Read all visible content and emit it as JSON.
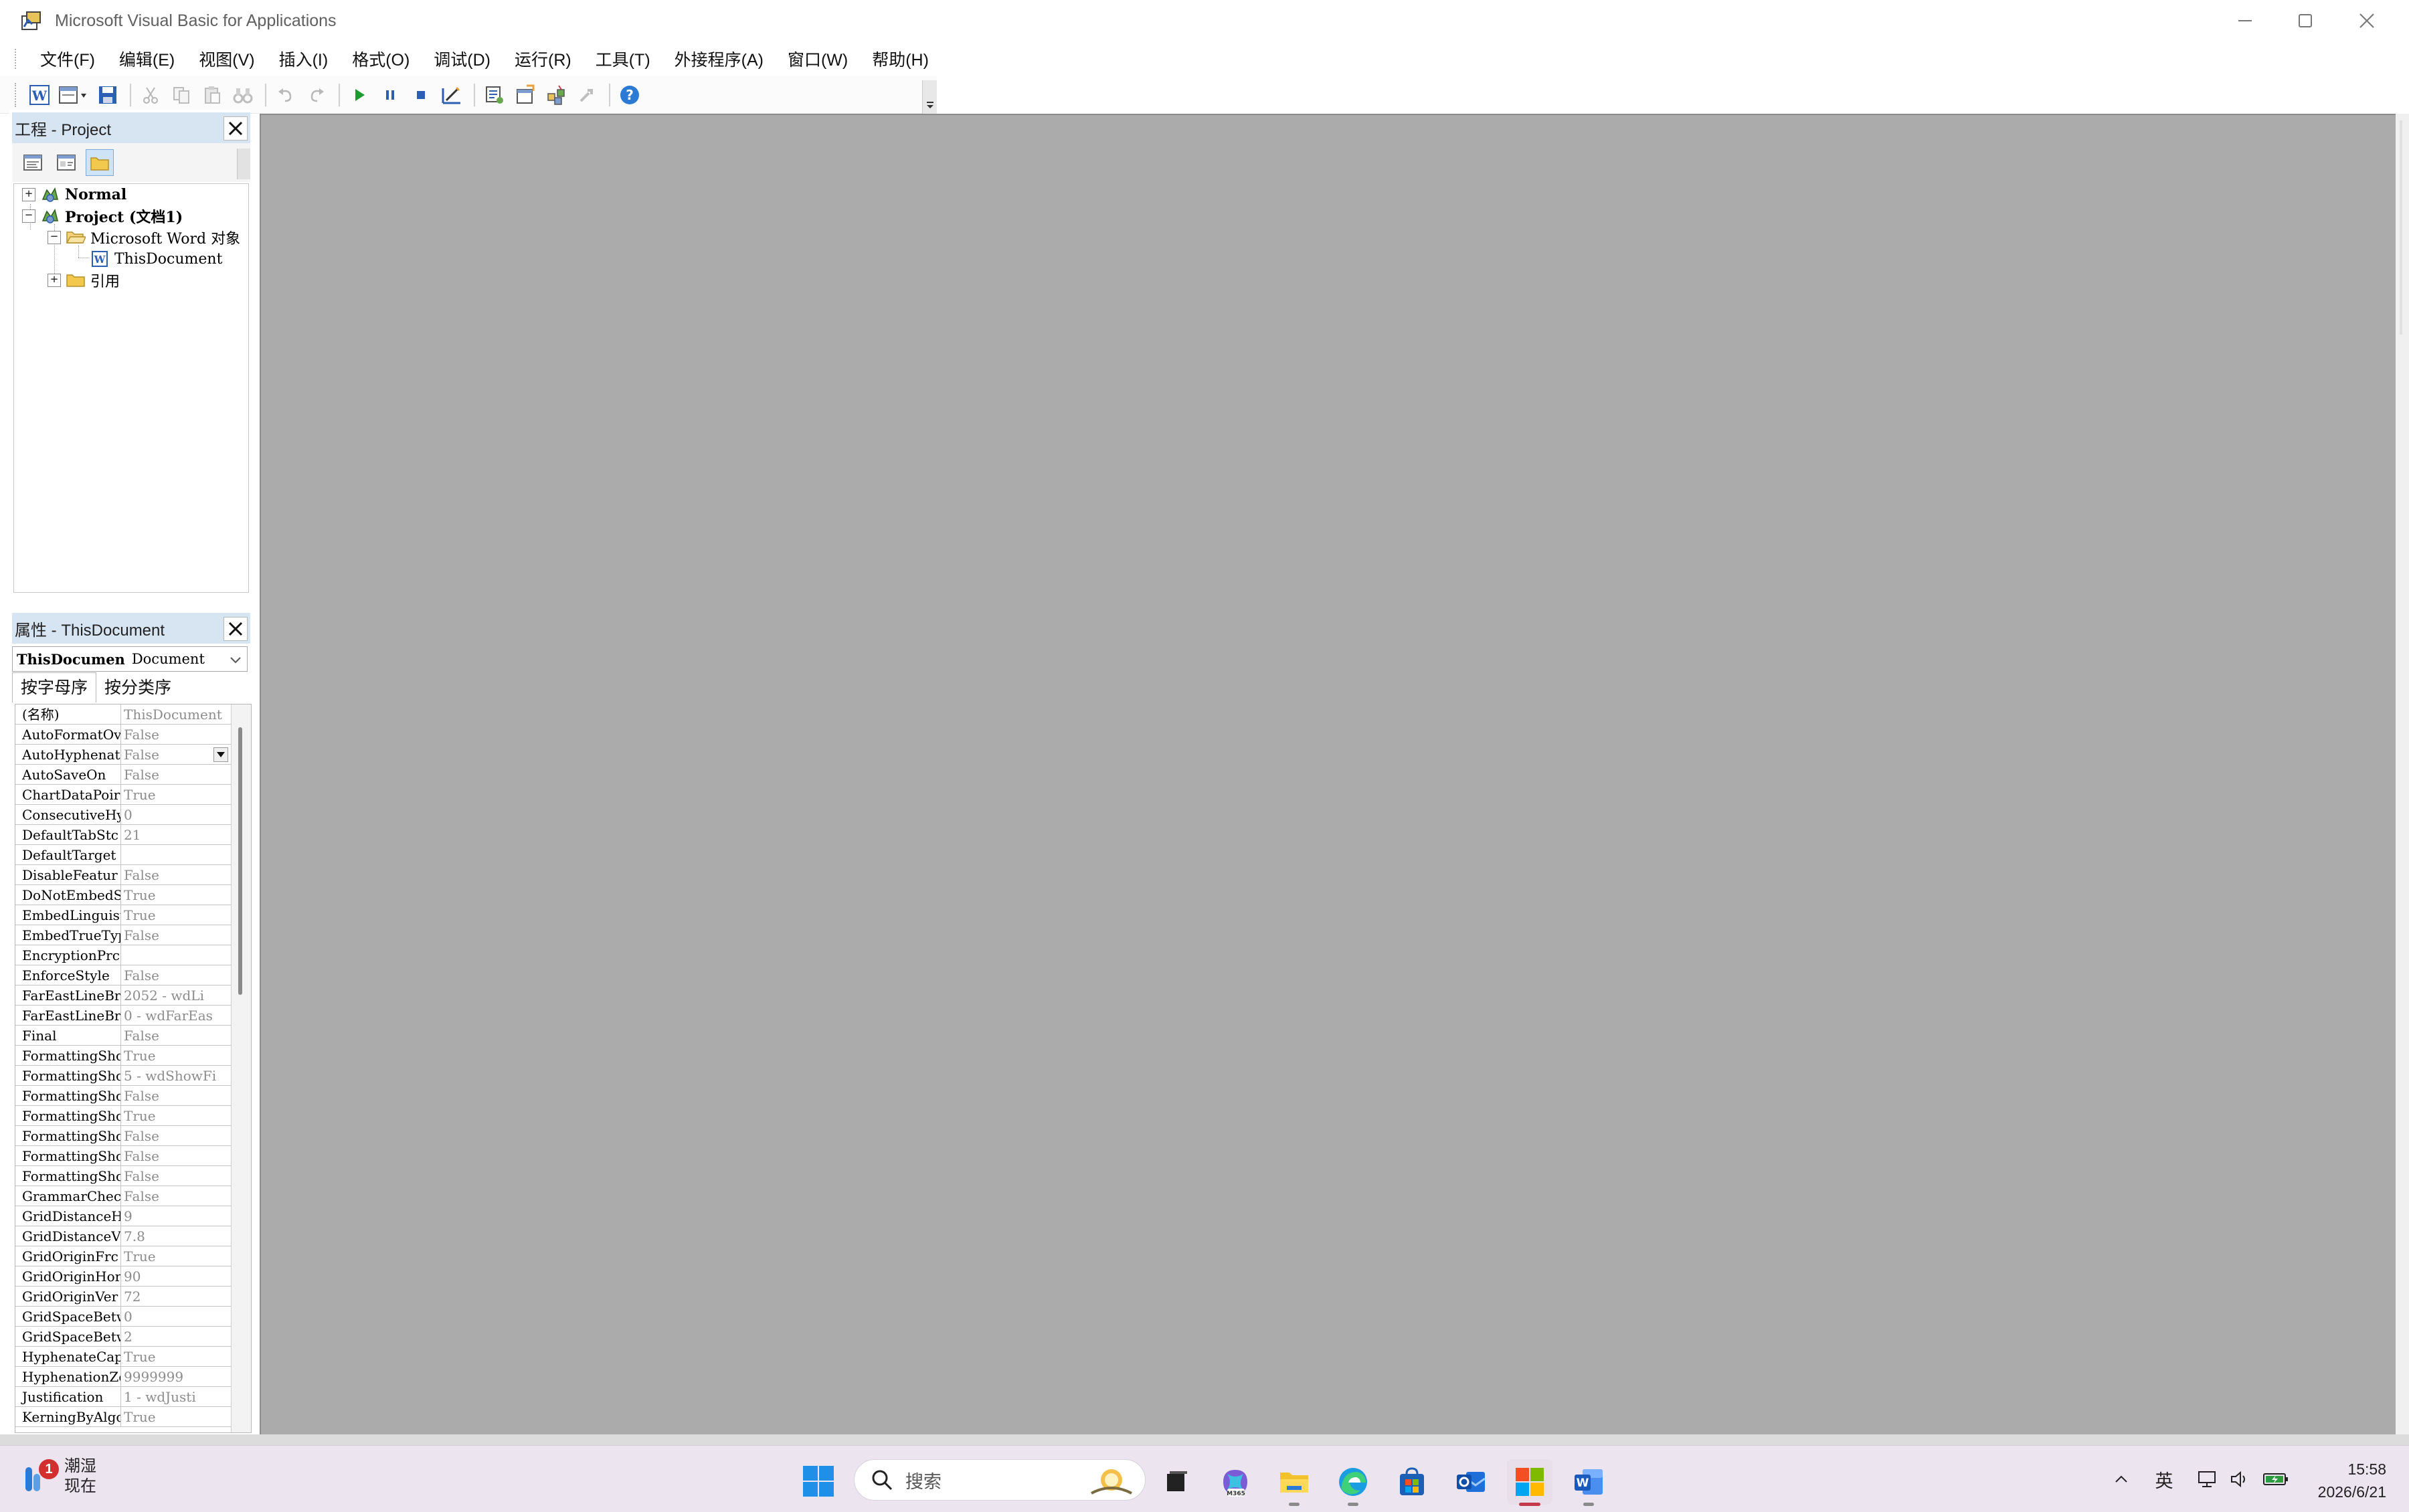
{
  "window": {
    "title": "Microsoft Visual Basic for Applications"
  },
  "menu": [
    "文件(F)",
    "编辑(E)",
    "视图(V)",
    "插入(I)",
    "格式(O)",
    "调试(D)",
    "运行(R)",
    "工具(T)",
    "外接程序(A)",
    "窗口(W)",
    "帮助(H)"
  ],
  "project_pane": {
    "title": "工程 - Project",
    "tree": [
      {
        "label": "Normal",
        "bold": true
      },
      {
        "label": "Project (文档1)",
        "bold": true
      },
      {
        "label": "Microsoft Word 对象",
        "bold": false
      },
      {
        "label": "ThisDocument",
        "bold": false
      },
      {
        "label": "引用",
        "bold": false
      }
    ]
  },
  "properties_pane": {
    "title": "属性 - ThisDocument",
    "object_name": "ThisDocumen",
    "object_class": "Document",
    "tabs": [
      "按字母序",
      "按分类序"
    ],
    "rows": [
      {
        "name": "(名称)",
        "value": "ThisDocument"
      },
      {
        "name": "AutoFormatOve",
        "value": "False"
      },
      {
        "name": "AutoHyphenati",
        "value": "False"
      },
      {
        "name": "AutoSaveOn",
        "value": "False"
      },
      {
        "name": "ChartDataPoir",
        "value": "True"
      },
      {
        "name": "ConsecutiveHy",
        "value": "0"
      },
      {
        "name": "DefaultTabStc",
        "value": "21"
      },
      {
        "name": "DefaultTarget",
        "value": ""
      },
      {
        "name": "DisableFeatur",
        "value": "False"
      },
      {
        "name": "DoNotEmbedSys",
        "value": "True"
      },
      {
        "name": "EmbedLinguist",
        "value": "True"
      },
      {
        "name": "EmbedTrueType",
        "value": "False"
      },
      {
        "name": "EncryptionPrc",
        "value": ""
      },
      {
        "name": "EnforceStyle",
        "value": "False"
      },
      {
        "name": "FarEastLineBr",
        "value": "2052 - wdLi"
      },
      {
        "name": "FarEastLineBr",
        "value": "0 - wdFarEas"
      },
      {
        "name": "Final",
        "value": "False"
      },
      {
        "name": "FormattingShc",
        "value": "True"
      },
      {
        "name": "FormattingShc",
        "value": "5 - wdShowFi"
      },
      {
        "name": "FormattingShc",
        "value": "False"
      },
      {
        "name": "FormattingShc",
        "value": "True"
      },
      {
        "name": "FormattingShc",
        "value": "False"
      },
      {
        "name": "FormattingShc",
        "value": "False"
      },
      {
        "name": "FormattingShc",
        "value": "False"
      },
      {
        "name": "GrammarChecke",
        "value": "False"
      },
      {
        "name": "GridDistanceH",
        "value": "9"
      },
      {
        "name": "GridDistanceV",
        "value": "7.8"
      },
      {
        "name": "GridOriginFrc",
        "value": "True"
      },
      {
        "name": "GridOriginHor",
        "value": "90"
      },
      {
        "name": "GridOriginVer",
        "value": "72"
      },
      {
        "name": "GridSpaceBetw",
        "value": "0"
      },
      {
        "name": "GridSpaceBetw",
        "value": "2"
      },
      {
        "name": "HyphenateCaps",
        "value": "True"
      },
      {
        "name": "HyphenationZc",
        "value": "9999999"
      },
      {
        "name": "Justification",
        "value": "1 - wdJusti"
      },
      {
        "name": "KerningByAlgc",
        "value": "True"
      }
    ]
  },
  "taskbar": {
    "weather_badge": "1",
    "weather_line1": "潮湿",
    "weather_line2": "现在",
    "search_placeholder": "搜索",
    "tray_lang": "英",
    "time": "15:58",
    "date": "2026/6/21"
  },
  "colors": {
    "mdi_background": "#ababab",
    "pane_header": "#d7e4f2",
    "taskbar": "#ece4ef",
    "run_green": "#1c9c2e",
    "vba_blue": "#2b5fb4"
  }
}
